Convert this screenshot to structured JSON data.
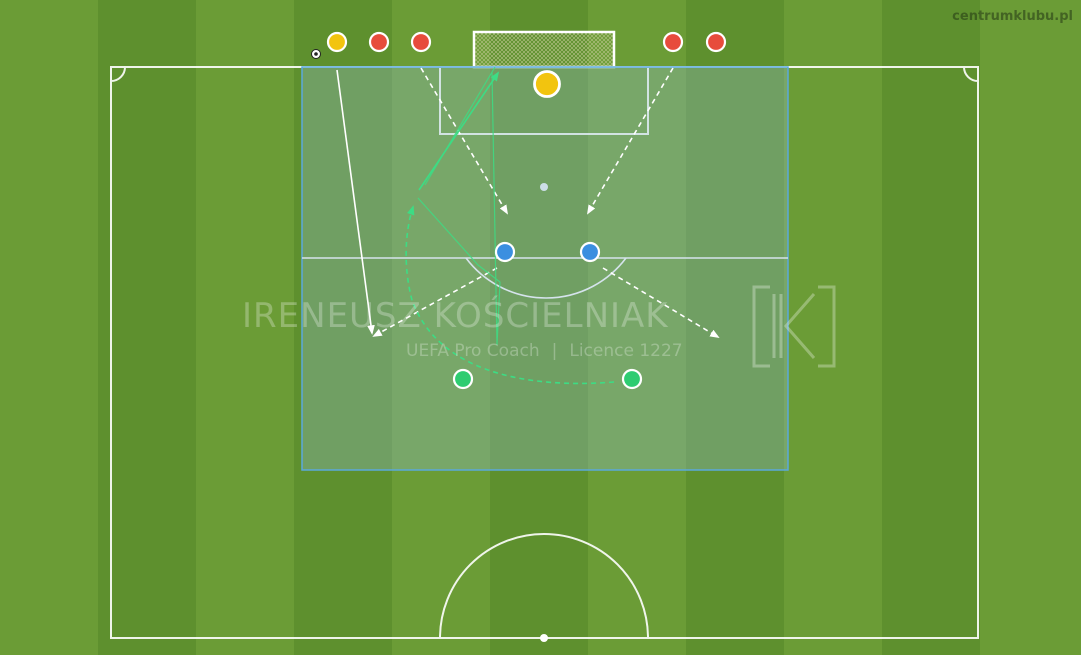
{
  "site": {
    "credit": "centrumklubu.pl"
  },
  "watermark": {
    "name": "IRENEUSZ KOŚCIELNIAK",
    "subtitle_left": "UEFA Pro Coach",
    "separator": "|",
    "subtitle_right": "Licence 1227",
    "monogram": "IK"
  },
  "colors": {
    "grass_light": "#689a35",
    "grass_dark": "#5b8d2c",
    "lines": "#ffffff",
    "zone_fill": "#8fb9cf",
    "zone_stroke": "#5aa9dc",
    "player_yellow": "#f2c40f",
    "player_red": "#e74c3c",
    "player_blue": "#3b8fe0",
    "player_green": "#2ecc71",
    "pass_green": "#3ddc84"
  },
  "players": [
    {
      "team": "yellow",
      "role": "server"
    },
    {
      "team": "red",
      "role": "attacker"
    },
    {
      "team": "red",
      "role": "attacker"
    },
    {
      "team": "red",
      "role": "attacker"
    },
    {
      "team": "red",
      "role": "attacker"
    },
    {
      "team": "yellow",
      "role": "goalkeeper"
    },
    {
      "team": "blue",
      "role": "defender"
    },
    {
      "team": "blue",
      "role": "defender"
    },
    {
      "team": "green",
      "role": "defender"
    },
    {
      "team": "green",
      "role": "defender"
    }
  ],
  "icons": {
    "ball": "football-icon",
    "goal": "goal-net-icon",
    "monogram": "ik-logo-icon"
  }
}
